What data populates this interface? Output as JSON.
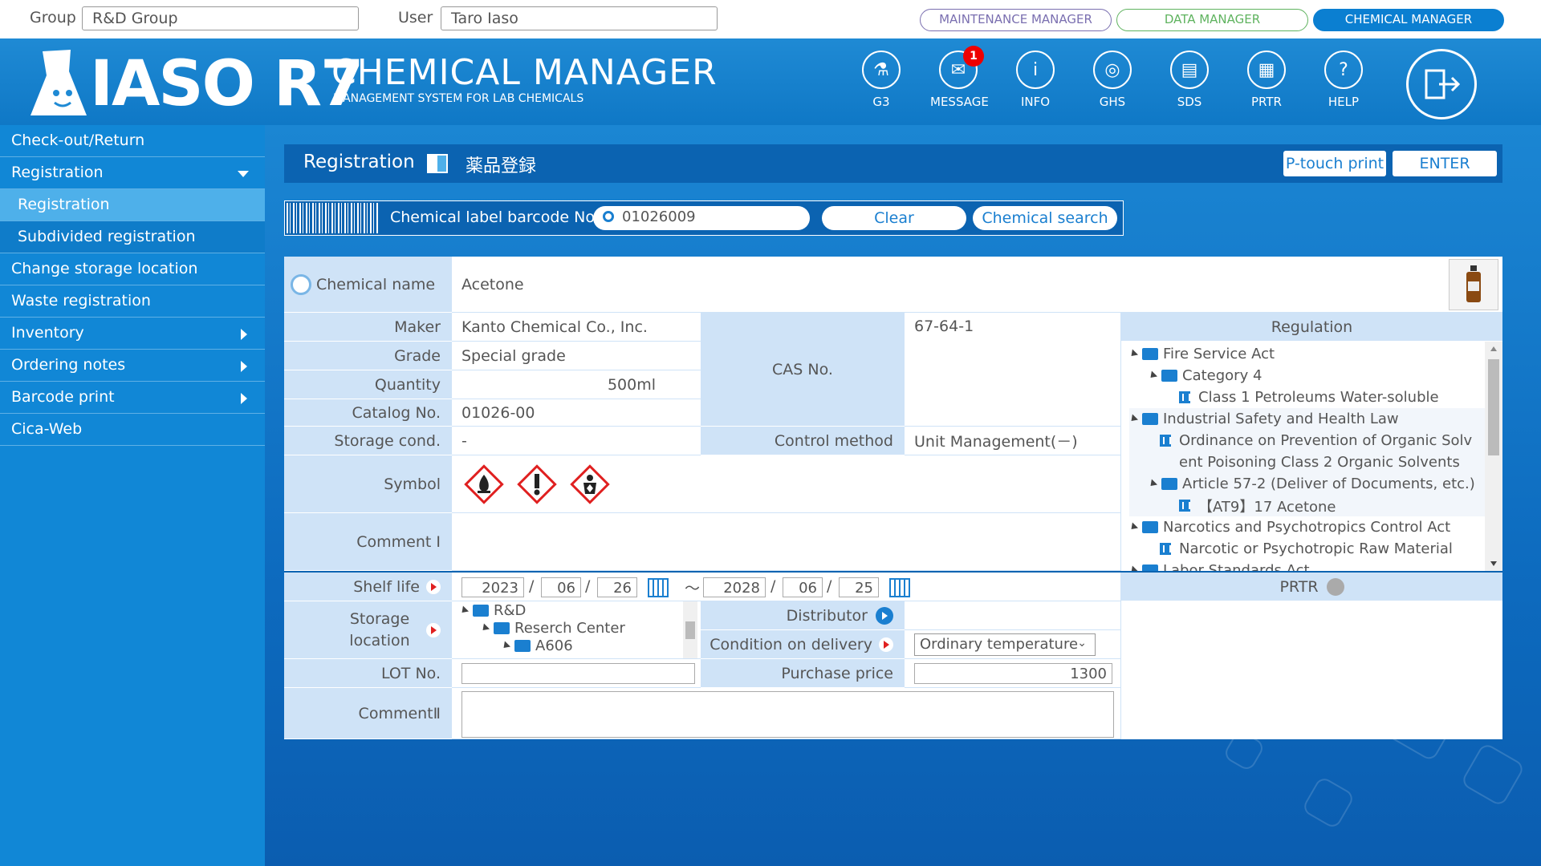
{
  "topbar": {
    "group_label": "Group",
    "group_value": "R&D Group",
    "user_label": "User",
    "user_value": "Taro Iaso",
    "roles": [
      "MAINTENANCE MANAGER",
      "DATA MANAGER",
      "CHEMICAL MANAGER"
    ]
  },
  "header": {
    "logo": "IASO R7",
    "title": "CHEMICAL MANAGER",
    "subtitle": "MANAGEMENT SYSTEM FOR LAB CHEMICALS",
    "icons": [
      {
        "label": "G3",
        "icon": "bottle-icon"
      },
      {
        "label": "MESSAGE",
        "icon": "mail-icon",
        "badge": "1"
      },
      {
        "label": "INFO",
        "icon": "info-icon"
      },
      {
        "label": "GHS",
        "icon": "globe-icon"
      },
      {
        "label": "SDS",
        "icon": "document-icon"
      },
      {
        "label": "PRTR",
        "icon": "factory-icon"
      },
      {
        "label": "HELP",
        "icon": "help-icon"
      }
    ]
  },
  "sidebar": {
    "items": [
      {
        "label": "Check-out/Return"
      },
      {
        "label": "Registration"
      },
      {
        "label": "Registration"
      },
      {
        "label": "Subdivided registration"
      },
      {
        "label": "Change storage location"
      },
      {
        "label": "Waste registration"
      },
      {
        "label": "Inventory"
      },
      {
        "label": "Ordering notes"
      },
      {
        "label": "Barcode print"
      },
      {
        "label": "Cica-Web"
      }
    ]
  },
  "page": {
    "title": "Registration",
    "title_jp": "薬品登録",
    "ptouch_label": "P-touch print",
    "enter_label": "ENTER"
  },
  "barcode": {
    "label": "Chemical label barcode No.",
    "value": "01026009",
    "clear_label": "Clear",
    "search_label": "Chemical search"
  },
  "form": {
    "chemical_name_label": "Chemical name",
    "chemical_name": "Acetone",
    "maker_label": "Maker",
    "maker": "Kanto Chemical Co., Inc.",
    "grade_label": "Grade",
    "grade": "Special grade",
    "quantity_label": "Quantity",
    "quantity": "500ml",
    "catalog_label": "Catalog No.",
    "catalog": "01026-00",
    "cas_label": "CAS No.",
    "cas": "67-64-1",
    "storage_cond_label": "Storage cond.",
    "storage_cond": "-",
    "control_method_label": "Control method",
    "control_method": "Unit Management(－)",
    "symbol_label": "Symbol",
    "symbols": [
      "flame-icon",
      "exclamation-icon",
      "health-hazard-icon"
    ],
    "comment1_label": "Comment I",
    "regulation_label": "Regulation",
    "regulations": [
      {
        "text": "Fire Service Act",
        "level": 0,
        "type": "folder"
      },
      {
        "text": "Category 4",
        "level": 1,
        "type": "folder"
      },
      {
        "text": "Class 1 Petroleums Water-soluble",
        "level": 2,
        "type": "doc"
      },
      {
        "text": "Industrial Safety and Health Law",
        "level": 0,
        "type": "folder"
      },
      {
        "text": "Ordinance on Prevention of Organic Solv",
        "level": 1,
        "type": "doc"
      },
      {
        "text": "ent Poisoning Class 2 Organic Solvents",
        "level": 1,
        "type": "cont"
      },
      {
        "text": "Article 57-2 (Deliver of Documents, etc.)",
        "level": 1,
        "type": "folder"
      },
      {
        "text": "【AT9】17 Acetone",
        "level": 2,
        "type": "doc"
      },
      {
        "text": "Narcotics and Psychotropics Control Act",
        "level": 0,
        "type": "folder"
      },
      {
        "text": "Narcotic or Psychotropic Raw Material",
        "level": 1,
        "type": "doc"
      },
      {
        "text": "Labor Standards Act",
        "level": 0,
        "type": "folder"
      }
    ],
    "shelf_life_label": "Shelf life",
    "shelf_from": {
      "y": "2023",
      "m": "06",
      "d": "26"
    },
    "shelf_to": {
      "y": "2028",
      "m": "06",
      "d": "25"
    },
    "tilde": "～",
    "slash": "/",
    "prtr_label": "PRTR",
    "storage_location_label": "Storage location",
    "storage_tree": [
      "R&D",
      "Reserch Center",
      "A606"
    ],
    "distributor_label": "Distributor",
    "condition_label": "Condition on delivery",
    "condition_value": "Ordinary temperature",
    "lot_label": "LOT No.",
    "purchase_price_label": "Purchase price",
    "purchase_price": "1300",
    "comment2_label": "CommentⅡ"
  },
  "colors": {
    "brand_blue": "#1a7fd0",
    "label_bg": "#cfe3f7",
    "hazard_red": "#e02020",
    "active_role": "#0b7fd1"
  }
}
